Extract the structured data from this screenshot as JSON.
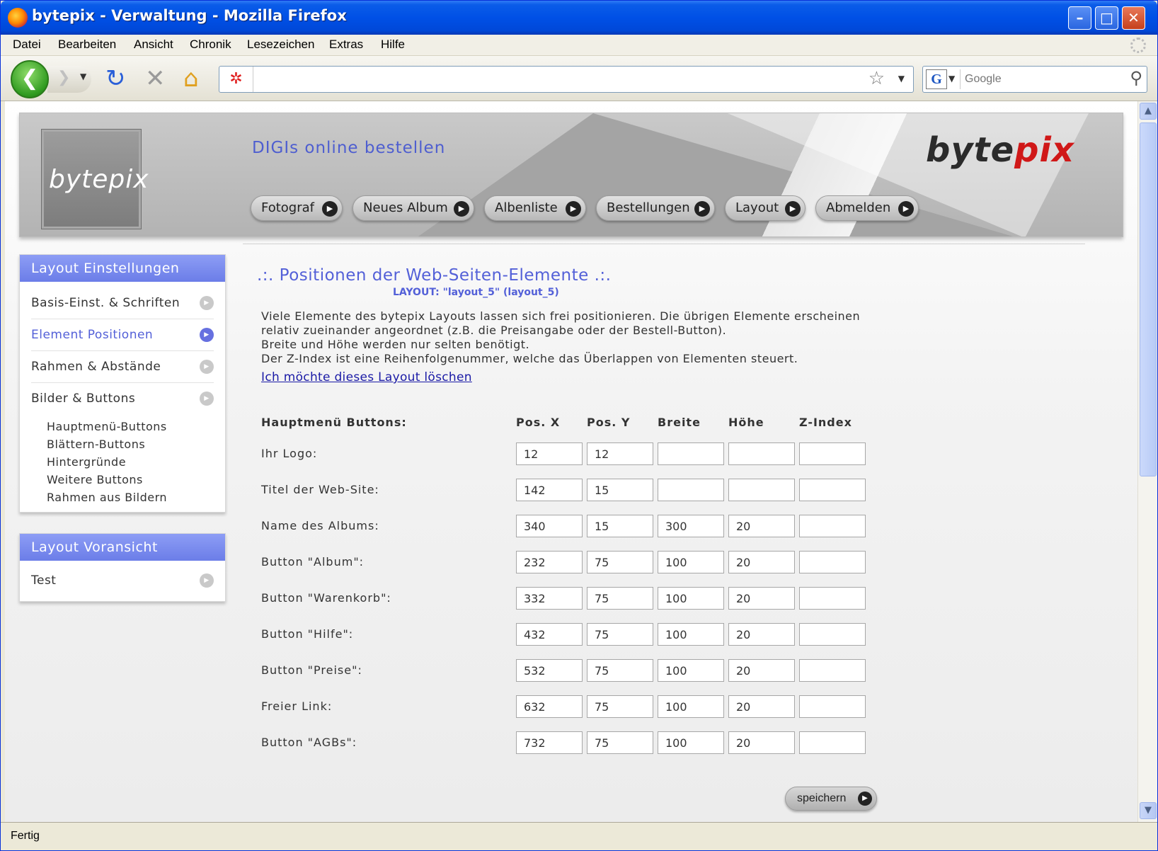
{
  "window": {
    "title": "bytepix - Verwaltung - Mozilla Firefox"
  },
  "menubar": [
    "Datei",
    "Bearbeiten",
    "Ansicht",
    "Chronik",
    "Lesezeichen",
    "Extras",
    "Hilfe"
  ],
  "toolbar": {
    "url_value": "",
    "search_placeholder": "Google"
  },
  "site": {
    "logo_text": "bytepix",
    "title": "DIGIs online bestellen",
    "brand_left": "byte",
    "brand_right": "pix",
    "nav": [
      "Fotograf",
      "Neues Album",
      "Albenliste",
      "Bestellungen",
      "Layout",
      "Abmelden"
    ]
  },
  "sidebar": {
    "settings_title": "Layout Einstellungen",
    "settings_items": [
      "Basis-Einst. & Schriften",
      "Element Positionen",
      "Rahmen & Abstände",
      "Bilder & Buttons"
    ],
    "sub_items": [
      "Hauptmenü-Buttons",
      "Blättern-Buttons",
      "Hintergründe",
      "Weitere Buttons",
      "Rahmen aus Bildern"
    ],
    "preview_title": "Layout Voransicht",
    "preview_items": [
      "Test"
    ]
  },
  "main": {
    "title": ".:. Positionen der Web-Seiten-Elemente .:.",
    "layout_label": "LAYOUT: \"layout_5\" (layout_5)",
    "intro": [
      "Viele Elemente des bytepix Layouts lassen sich frei positionieren. Die übrigen Elemente erscheinen",
      "relativ zueinander angeordnet (z.B. die Preisangabe oder der Bestell-Button).",
      "Breite und Höhe werden nur selten benötigt.",
      "Der Z-Index ist eine Reihenfolgenummer, welche das Überlappen von Elementen steuert."
    ],
    "delete_link": "Ich möchte dieses Layout löschen",
    "table": {
      "header_label": "Hauptmenü Buttons:",
      "columns": [
        "Pos. X",
        "Pos. Y",
        "Breite",
        "Höhe",
        "Z-Index"
      ],
      "rows": [
        {
          "label": "Ihr Logo:",
          "values": [
            "12",
            "12",
            "",
            "",
            ""
          ]
        },
        {
          "label": "Titel der Web-Site:",
          "values": [
            "142",
            "15",
            "",
            "",
            ""
          ]
        },
        {
          "label": "Name des Albums:",
          "values": [
            "340",
            "15",
            "300",
            "20",
            ""
          ]
        },
        {
          "label": "Button \"Album\":",
          "values": [
            "232",
            "75",
            "100",
            "20",
            ""
          ]
        },
        {
          "label": "Button \"Warenkorb\":",
          "values": [
            "332",
            "75",
            "100",
            "20",
            ""
          ]
        },
        {
          "label": "Button \"Hilfe\":",
          "values": [
            "432",
            "75",
            "100",
            "20",
            ""
          ]
        },
        {
          "label": "Button \"Preise\":",
          "values": [
            "532",
            "75",
            "100",
            "20",
            ""
          ]
        },
        {
          "label": "Freier Link:",
          "values": [
            "632",
            "75",
            "100",
            "20",
            ""
          ]
        },
        {
          "label": "Button \"AGBs\":",
          "values": [
            "732",
            "75",
            "100",
            "20",
            ""
          ]
        }
      ]
    },
    "save_label": "speichern"
  },
  "status": {
    "text": "Fertig"
  }
}
